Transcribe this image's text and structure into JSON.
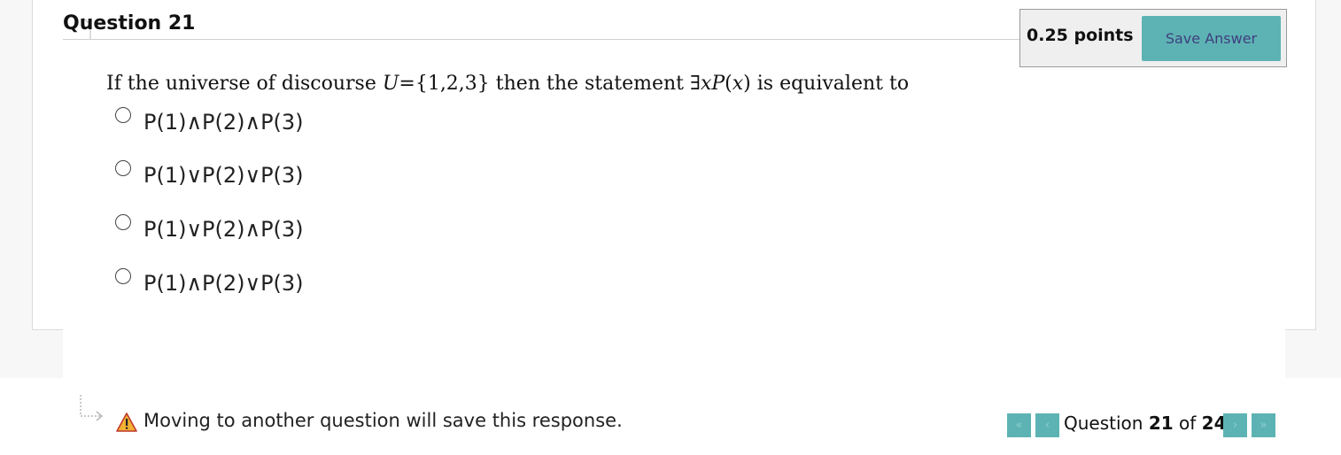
{
  "question": {
    "title": "Question 21",
    "points": "0.25 points",
    "save_label": "Save Answer",
    "stem": {
      "pre": "If the universe of discourse ",
      "math1": "U",
      "mid1": "={1,2,3} then the statement ∃",
      "math2": "xP",
      "mid2": "(",
      "math3": "x",
      "post": ") is equivalent to"
    },
    "options": [
      {
        "label": "P(1)∧P(2)∧P(3)",
        "selected": false
      },
      {
        "label": "P(1)∨P(2)∨P(3)",
        "selected": false
      },
      {
        "label": "P(1)∨P(2)∧P(3)",
        "selected": false
      },
      {
        "label": "P(1)∧P(2)∨P(3)",
        "selected": false
      }
    ]
  },
  "footer": {
    "message": "Moving to another question will save this response.",
    "nav": {
      "prefix": "Question",
      "current": "21",
      "of": "of",
      "total": "24"
    },
    "icons": [
      "return-arrow-icon",
      "warning-icon",
      "first-page-icon",
      "prev-page-icon",
      "next-page-icon",
      "last-page-icon"
    ]
  },
  "colors": {
    "accent": "#5db3b3",
    "button_text": "#3f3f80",
    "points_box_bg": "#efefef"
  }
}
